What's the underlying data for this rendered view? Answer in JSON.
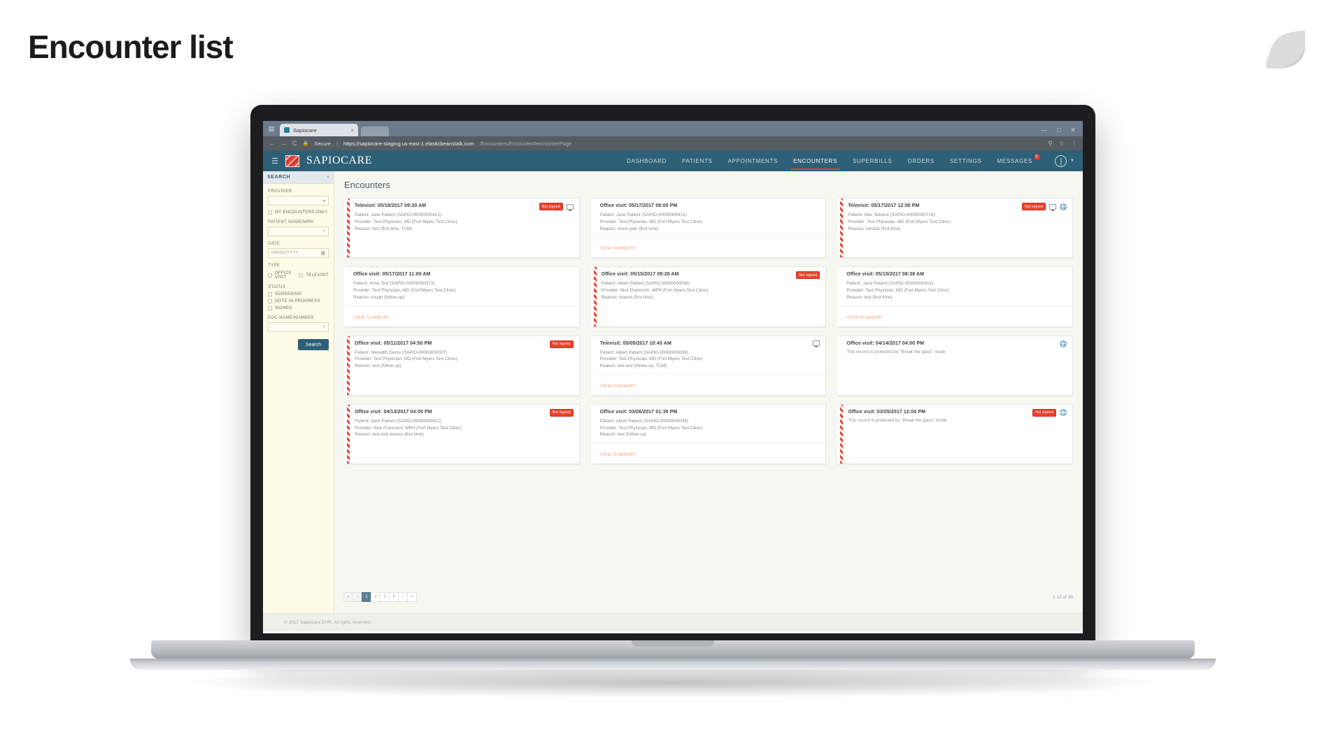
{
  "slide": {
    "title": "Encounter list",
    "logo_icon": "leaf-mark-icon"
  },
  "browser": {
    "tab_title": "Sapiocare",
    "tab_close": "×",
    "back_icon": "←",
    "forward_icon": "→",
    "reload_icon": "C",
    "lock_icon": "🔒",
    "secure_label": "Secure",
    "url_separator": "|",
    "url_domain": "https://sapiocare-staging.us-east-1.elasticbeanstalk.com",
    "url_path": "/Encounters/Encounter#encounterPage",
    "star_icon": "☆",
    "menu_icon": "⋮",
    "profile_icon": "⚲",
    "win_minimize": "—",
    "win_maximize": "□",
    "win_close": "✕"
  },
  "app": {
    "hamburger_icon": "☰",
    "logo_text": "SAPIOCARE",
    "nav": [
      {
        "label": "DASHBOARD",
        "active": false,
        "badge": null
      },
      {
        "label": "PATIENTS",
        "active": false,
        "badge": null
      },
      {
        "label": "APPOINTMENTS",
        "active": false,
        "badge": null
      },
      {
        "label": "ENCOUNTERS",
        "active": true,
        "badge": null
      },
      {
        "label": "SUPERBILLS",
        "active": false,
        "badge": null
      },
      {
        "label": "ORDERS",
        "active": false,
        "badge": null
      },
      {
        "label": "SETTINGS",
        "active": false,
        "badge": null
      },
      {
        "label": "MESSAGES",
        "active": false,
        "badge": "3"
      }
    ],
    "avatar_icon": "user-avatar-icon",
    "caret_icon": "▼"
  },
  "sidebar": {
    "header": "SEARCH",
    "collapse_icon": "«",
    "provider_label": "PROVIDER",
    "provider_value": "",
    "provider_caret": "▾",
    "my_encounters_label": "MY ENCOUNTERS ONLY",
    "patient_label": "PATIENT NAME/MRN",
    "patient_value": "",
    "search_icon": "⌕",
    "date_label": "DATE",
    "date_placeholder": "MM/DD/YYYY",
    "calendar_icon": "▦",
    "type_label": "TYPE",
    "type_options": [
      "OFFICE VISIT",
      "TELEVISIT"
    ],
    "status_label": "STATUS",
    "status_options": [
      "SCREENING",
      "NOTE IN PROGRESS",
      "SIGNED"
    ],
    "eoc_label": "EOC NAME/NUMBER",
    "eoc_value": "",
    "search_button": "Search"
  },
  "main": {
    "page_title": "Encounters",
    "cards": [
      {
        "title": "Televisit: 05/18/2017 09:30 AM",
        "patient": "Patient: Jane Patient (SAPIO-00000000412)",
        "provider": "Provider: Test Physician, MD (Fort Myers Test Clinic)",
        "reason": "Reason: test (first time, TCM)",
        "protected_text": null,
        "badge": "Not signed",
        "icons": [
          "monitor-icon"
        ],
        "view_summary": null,
        "flagged": true
      },
      {
        "title": "Office visit: 05/17/2017 08:00 PM",
        "patient": "Patient: Jane Patient (SAPIO-00000000412)",
        "provider": "Provider: Test Physician, MD (Fort Myers Test Clinic)",
        "reason": "Reason: chest pain (first time)",
        "protected_text": null,
        "badge": null,
        "icons": [],
        "view_summary": "VIEW SUMMARY",
        "flagged": false
      },
      {
        "title": "Televisit: 05/17/2017 12:00 PM",
        "patient": "Patient: Alex Teletest (SAPIO-00000000719)",
        "provider": "Provider: Test Physician, MD (Fort Myers Test Clinic)",
        "reason": "Reason: consult (first time)",
        "protected_text": null,
        "badge": "Not signed",
        "icons": [
          "monitor-icon",
          "shield-icon"
        ],
        "view_summary": null,
        "flagged": true
      },
      {
        "title": "Office visit: 05/17/2017 11:00 AM",
        "patient": "Patient: Anna Test (SAPIO-00000000372)",
        "provider": "Provider: Test Physician, MD (Fort Myers Test Clinic)",
        "reason": "Reason: cough (follow-up)",
        "protected_text": null,
        "badge": null,
        "icons": [],
        "view_summary": "VIEW SUMMARY",
        "flagged": false
      },
      {
        "title": "Office visit: 05/15/2017 09:26 AM",
        "patient": "Patient: Albert Patient (SAPIO-00000000036)",
        "provider": "Provider: Nick Pranovich, MPH (Fort Myers Test Clinic)",
        "reason": "Reason: reason (first time)",
        "protected_text": null,
        "badge": "Not signed",
        "icons": [],
        "view_summary": null,
        "flagged": true
      },
      {
        "title": "Office visit: 05/15/2017 08:39 AM",
        "patient": "Patient: Jane Patient (SAPIO-00000000412)",
        "provider": "Provider: Test Physician, MD (Fort Myers Test Clinic)",
        "reason": "Reason: test (first time)",
        "protected_text": null,
        "badge": null,
        "icons": [],
        "view_summary": "VIEW SUMMARY",
        "flagged": false
      },
      {
        "title": "Office visit: 05/11/2017 04:50 PM",
        "patient": "Patient: Meredith Demo (SAPIO-00000000027)",
        "provider": "Provider: Test Physician, MD (Fort Myers Test Clinic)",
        "reason": "Reason: test (follow-up)",
        "protected_text": null,
        "badge": "Not signed",
        "icons": [],
        "view_summary": null,
        "flagged": true
      },
      {
        "title": "Televisit: 05/05/2017 10:45 AM",
        "patient": "Patient: Albert Patient (SAPIO-00000000036)",
        "provider": "Provider: Test Physician, MD (Fort Myers Test Clinic)",
        "reason": "Reason: tele test (follow-up, TCM)",
        "protected_text": null,
        "badge": null,
        "icons": [
          "monitor-icon"
        ],
        "view_summary": "VIEW SUMMARY",
        "flagged": false
      },
      {
        "title": "Office visit: 04/14/2017 04:00 PM",
        "patient": null,
        "provider": null,
        "reason": null,
        "protected_text": "This record is protected by \"Break the glass\" mode",
        "badge": null,
        "icons": [
          "shield-icon"
        ],
        "view_summary": null,
        "flagged": false
      },
      {
        "title": "Office visit: 04/13/2017 04:00 PM",
        "patient": "Patient: Jane Patient (SAPIO-00000000412)",
        "provider": "Provider: Nick Pranovich, MPH (Fort Myers Test Clinic)",
        "reason": "Reason: test visit reason (first time)",
        "protected_text": null,
        "badge": "Not signed",
        "icons": [],
        "view_summary": null,
        "flagged": true
      },
      {
        "title": "Office visit: 03/06/2017 01:30 PM",
        "patient": "Patient: Albert Patient (SAPIO-00000000036)",
        "provider": "Provider: Test Physician, MD (Fort Myers Test Clinic)",
        "reason": "Reason: test (follow-up)",
        "protected_text": null,
        "badge": null,
        "icons": [],
        "view_summary": "VIEW SUMMARY",
        "flagged": false
      },
      {
        "title": "Office visit: 03/05/2017 12:04 PM",
        "patient": null,
        "provider": null,
        "reason": null,
        "protected_text": "This record is protected by \"Break the glass\" mode",
        "badge": "Not signed",
        "icons": [
          "shield-icon"
        ],
        "view_summary": null,
        "flagged": true
      }
    ],
    "pagination": {
      "first_icon": "«",
      "prev_icon": "‹",
      "pages": [
        "1",
        "2",
        "3",
        "4"
      ],
      "current_page": "1",
      "next_icon": "›",
      "last_icon": "»",
      "count_text": "1-12 of 38"
    }
  },
  "footer": {
    "copyright": "© 2017 Sapiocare EHR. All rights reserved."
  },
  "colors": {
    "brand_teal": "#2d6076",
    "accent_red": "#e8432f",
    "sidebar_cream": "#fdfae6",
    "link_orange": "#f0a07a"
  }
}
